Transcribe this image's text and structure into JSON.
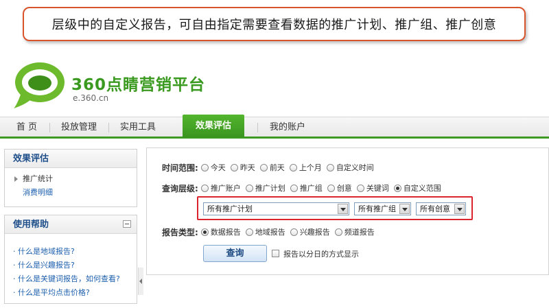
{
  "callout": {
    "text": "层级中的自定义报告，可自由指定需要查看数据的推广计划、推广组、推广创意"
  },
  "logo": {
    "title": "360点睛营销平台",
    "url": "e.360.cn",
    "brand_color": "#3a9a1f"
  },
  "nav": {
    "items": [
      "首 页",
      "投放管理",
      "实用工具",
      "效果评估",
      "我的账户"
    ],
    "active": "效果评估"
  },
  "sidebar": {
    "eval": {
      "title": "效果评估",
      "items": [
        "推广统计"
      ],
      "links": [
        "消费明细"
      ]
    },
    "help": {
      "title": "使用帮助",
      "links": [
        "· 什么是地域报告?",
        "· 什么是兴趣报告?",
        "· 什么是关键词报告，如何查看?",
        "· 什么是平均点击价格?"
      ]
    }
  },
  "form": {
    "time": {
      "label": "时间范围:",
      "options": [
        "今天",
        "昨天",
        "前天",
        "上个月",
        "自定义时间"
      ],
      "selected": ""
    },
    "level": {
      "label": "查询层级:",
      "options": [
        "推广账户",
        "推广计划",
        "推广组",
        "创意",
        "关键词",
        "自定义范围"
      ],
      "selected": "自定义范围"
    },
    "dropdowns": {
      "plan": "所有推广计划",
      "group": "所有推广组",
      "creative": "所有创意"
    },
    "report_type": {
      "label": "报告类型:",
      "options": [
        "数据报告",
        "地域报告",
        "兴趣报告",
        "频道报告"
      ],
      "selected": "数据报告"
    },
    "query_button": "查询",
    "daily_checkbox_label": "报告以分日的方式显示"
  },
  "colors": {
    "accent_green": "#3d9a23",
    "highlight_red": "#d9232d",
    "callout_border": "#d9532b",
    "link_blue": "#1d5fae"
  }
}
